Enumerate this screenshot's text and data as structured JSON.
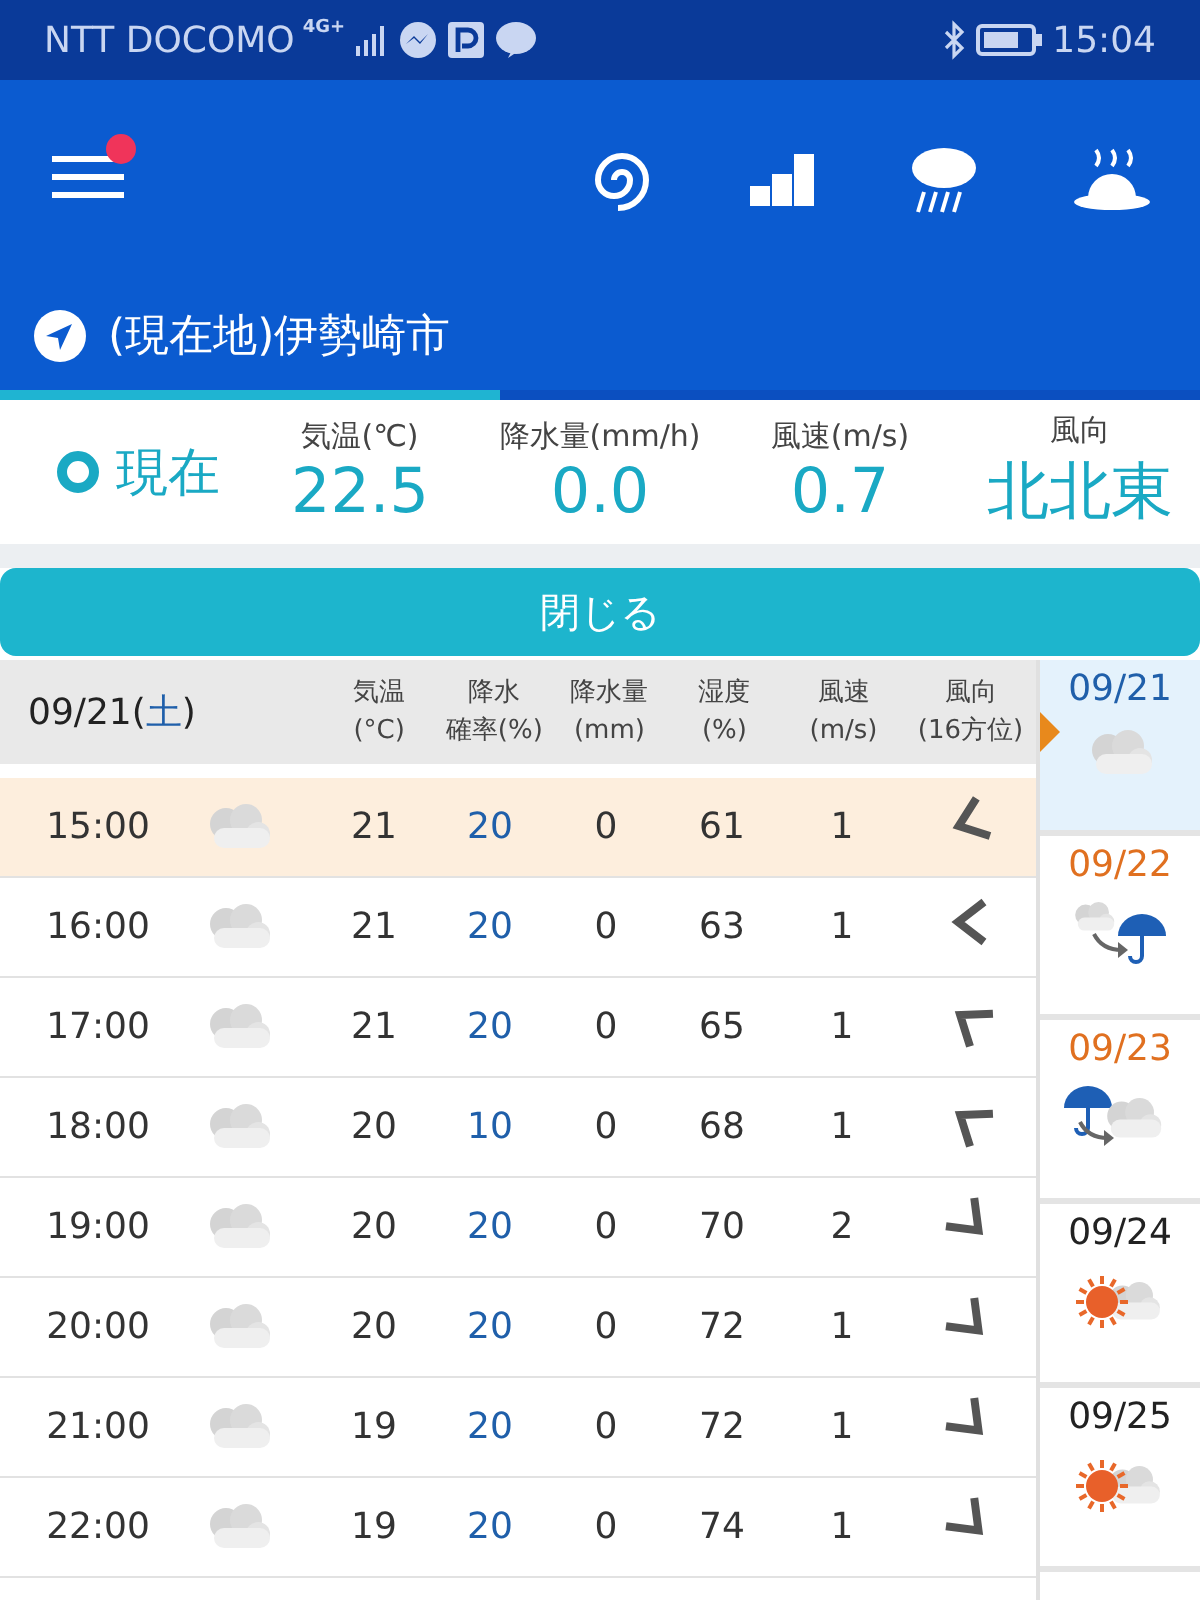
{
  "status_bar": {
    "carrier": "NTT DOCOMO",
    "network": "4G+",
    "time": "15:04"
  },
  "header": {
    "menu_badge": true
  },
  "location": {
    "name": "(現在地)伊勢崎市"
  },
  "current": {
    "label": "現在",
    "readings": [
      {
        "heading": "気温(℃)",
        "value": "22.5"
      },
      {
        "heading": "降水量(mm/h)",
        "value": "0.0"
      },
      {
        "heading": "風速(m/s)",
        "value": "0.7"
      },
      {
        "heading": "風向",
        "value": "北北東"
      }
    ]
  },
  "close_button": "閉じる",
  "table": {
    "date": "09/21",
    "weekday": "土",
    "brackets": [
      "(",
      ")"
    ],
    "columns": [
      {
        "line1": "気温",
        "line2": "(°C)"
      },
      {
        "line1": "降水",
        "line2": "確率(%)"
      },
      {
        "line1": "降水量",
        "line2": "(mm)"
      },
      {
        "line1": "湿度",
        "line2": "(%)"
      },
      {
        "line1": "風速",
        "line2": "(m/s)"
      },
      {
        "line1": "風向",
        "line2": "(16方位)"
      }
    ],
    "rows": [
      {
        "time": "15:00",
        "weather": {
          "kind": "cloudy"
        },
        "temp": "21",
        "chance": "20",
        "rain": "0",
        "humidity": "61",
        "wind": "1",
        "bearing": {
          "kind": "wsw"
        },
        "selected": true
      },
      {
        "time": "16:00",
        "weather": {
          "kind": "cloudy"
        },
        "temp": "21",
        "chance": "20",
        "rain": "0",
        "humidity": "63",
        "wind": "1",
        "bearing": {
          "kind": "w"
        },
        "selected": false
      },
      {
        "time": "17:00",
        "weather": {
          "kind": "cloudy"
        },
        "temp": "21",
        "chance": "20",
        "rain": "0",
        "humidity": "65",
        "wind": "1",
        "bearing": {
          "kind": "nw"
        },
        "selected": false
      },
      {
        "time": "18:00",
        "weather": {
          "kind": "cloudy"
        },
        "temp": "20",
        "chance": "10",
        "rain": "0",
        "humidity": "68",
        "wind": "1",
        "bearing": {
          "kind": "nw"
        },
        "selected": false
      },
      {
        "time": "19:00",
        "weather": {
          "kind": "cloudy"
        },
        "temp": "20",
        "chance": "20",
        "rain": "0",
        "humidity": "70",
        "wind": "2",
        "bearing": {
          "kind": "se"
        },
        "selected": false
      },
      {
        "time": "20:00",
        "weather": {
          "kind": "cloudy"
        },
        "temp": "20",
        "chance": "20",
        "rain": "0",
        "humidity": "72",
        "wind": "1",
        "bearing": {
          "kind": "se"
        },
        "selected": false
      },
      {
        "time": "21:00",
        "weather": {
          "kind": "cloudy"
        },
        "temp": "19",
        "chance": "20",
        "rain": "0",
        "humidity": "72",
        "wind": "1",
        "bearing": {
          "kind": "se"
        },
        "selected": false
      },
      {
        "time": "22:00",
        "weather": {
          "kind": "cloudy"
        },
        "temp": "19",
        "chance": "20",
        "rain": "0",
        "humidity": "74",
        "wind": "1",
        "bearing": {
          "kind": "se"
        },
        "selected": false
      }
    ]
  },
  "days": [
    {
      "date": "09/21",
      "weather": {
        "kind": "cloudy"
      },
      "color": "#1f5faa",
      "selected": true
    },
    {
      "date": "09/22",
      "weather": {
        "kind": "cloudy-then-rain"
      },
      "color": "#e07020",
      "selected": false
    },
    {
      "date": "09/23",
      "weather": {
        "kind": "rain-then-cloudy"
      },
      "color": "#e07020",
      "selected": false
    },
    {
      "date": "09/24",
      "weather": {
        "kind": "sunny-cloudy"
      },
      "color": "#222222",
      "selected": false
    },
    {
      "date": "09/25",
      "weather": {
        "kind": "sunny-cloudy"
      },
      "color": "#222222",
      "selected": false
    }
  ]
}
